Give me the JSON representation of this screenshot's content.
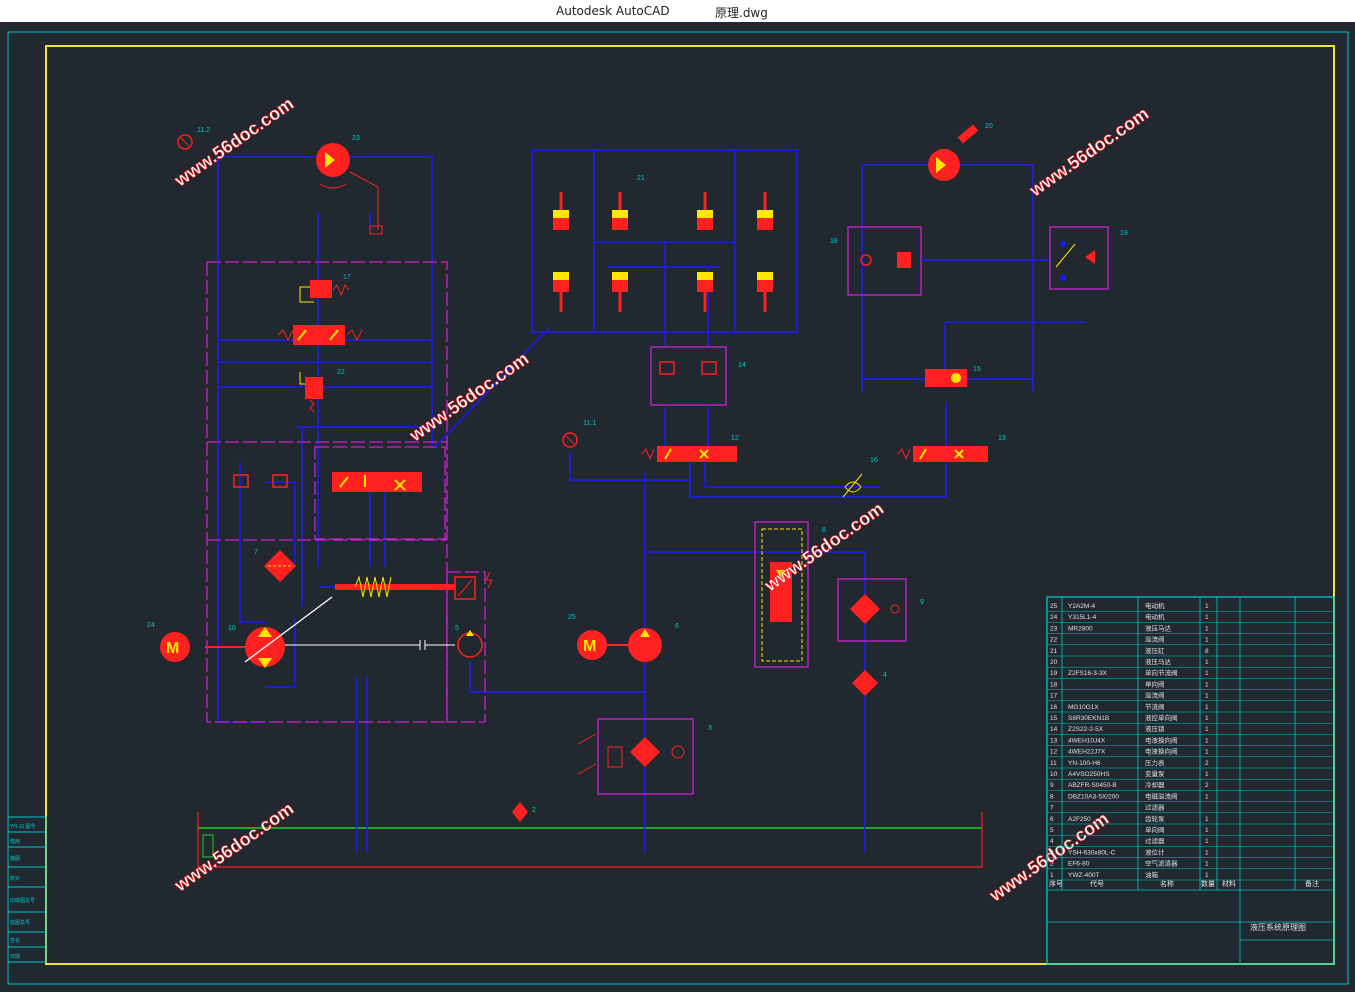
{
  "window": {
    "app_title": "Autodesk AutoCAD",
    "document_title": "原理.dwg"
  },
  "colors": {
    "background": "#212830",
    "frame": "#00c8c8",
    "border": "#f0e040",
    "hydraulic": "#1a1aff",
    "subassembly": "#d020d0",
    "component": "#ff2020",
    "ground": "#20d020"
  },
  "watermark": "www.56doc.com",
  "drawing_title": "液压系统原理图",
  "labels": [
    "11.2",
    "23",
    "17",
    "22",
    "21",
    "14",
    "11.1",
    "12",
    "16",
    "13",
    "20",
    "18",
    "19",
    "15",
    "24",
    "10",
    "7",
    "5",
    "25",
    "6",
    "8",
    "9",
    "4",
    "3",
    "2"
  ],
  "bom_rows": [
    {
      "no": "25",
      "code": "Y2A2M-4",
      "name": "电动机",
      "qty": "1"
    },
    {
      "no": "24",
      "code": "Y315L1-4",
      "name": "电动机",
      "qty": "1"
    },
    {
      "no": "23",
      "code": "MR2800",
      "name": "液压马达",
      "qty": "1"
    },
    {
      "no": "22",
      "code": "",
      "name": "溢流阀",
      "qty": "1"
    },
    {
      "no": "21",
      "code": "",
      "name": "液压缸",
      "qty": "8"
    },
    {
      "no": "20",
      "code": "",
      "name": "液压马达",
      "qty": "1"
    },
    {
      "no": "19",
      "code": "Z2FS16-3-3X",
      "name": "单向节流阀",
      "qty": "1"
    },
    {
      "no": "18",
      "code": "",
      "name": "单向阀",
      "qty": "1"
    },
    {
      "no": "17",
      "code": "",
      "name": "溢流阀",
      "qty": "1"
    },
    {
      "no": "16",
      "code": "MG10G1X",
      "name": "节流阀",
      "qty": "1"
    },
    {
      "no": "15",
      "code": "S8R30EKN1B",
      "name": "液控单向阀",
      "qty": "1"
    },
    {
      "no": "14",
      "code": "Z2S22-2-5X",
      "name": "液压锁",
      "qty": "1"
    },
    {
      "no": "13",
      "code": "4WEH10J4X",
      "name": "电液换向阀",
      "qty": "1"
    },
    {
      "no": "12",
      "code": "4WEH22J7X",
      "name": "电液换向阀",
      "qty": "1"
    },
    {
      "no": "11",
      "code": "YN-100-H6",
      "name": "压力表",
      "qty": "2"
    },
    {
      "no": "10",
      "code": "A4VSO250HS",
      "name": "变量泵",
      "qty": "1"
    },
    {
      "no": "9",
      "code": "ABZFR-S0450-B",
      "name": "冷却器",
      "qty": "2"
    },
    {
      "no": "8",
      "code": "DBZ10A3-5X/200",
      "name": "电磁溢流阀",
      "qty": "1"
    },
    {
      "no": "7",
      "code": "",
      "name": "过滤器",
      "qty": ""
    },
    {
      "no": "6",
      "code": "A2F250",
      "name": "齿轮泵",
      "qty": "1"
    },
    {
      "no": "5",
      "code": "",
      "name": "单向阀",
      "qty": "1"
    },
    {
      "no": "4",
      "code": "",
      "name": "过滤器",
      "qty": "1"
    },
    {
      "no": "3",
      "code": "YSH-630x80L-C",
      "name": "液位计",
      "qty": "1"
    },
    {
      "no": "2",
      "code": "EF6-80",
      "name": "空气滤清器",
      "qty": "1"
    },
    {
      "no": "1",
      "code": "YWZ-400T",
      "name": "油箱",
      "qty": "1"
    }
  ],
  "bom_header": {
    "no": "序号",
    "code": "代号",
    "name": "名称",
    "qty": "数量",
    "mat": "材料",
    "note": "备注"
  },
  "left_strip": [
    "YH-10 图号",
    "借用",
    "描图",
    "校对",
    "旧底图总号",
    "底图总号",
    "签名",
    "日期"
  ]
}
